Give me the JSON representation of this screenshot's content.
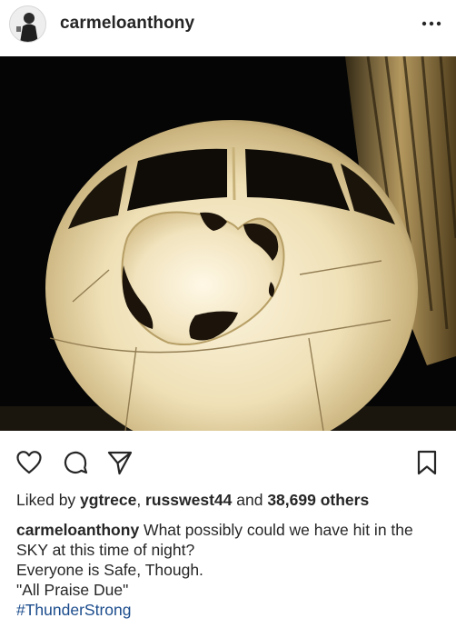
{
  "post": {
    "username": "carmeloanthony",
    "more_icon": "ellipsis-icon",
    "likes": {
      "prefix": "Liked by ",
      "user1": "ygtrece",
      "sep": ", ",
      "user2": "russwest44",
      "middle": " and ",
      "count": "38,699 others"
    },
    "caption": {
      "username": "carmeloanthony",
      "text": " What possibly could we have hit in the SKY at this time of night?",
      "line2": "Everyone is Safe, Though.",
      "line3": "\"All Praise Due\"",
      "hashtag": "#ThunderStrong"
    },
    "actions": [
      "heart-icon",
      "comment-icon",
      "share-icon",
      "bookmark-icon"
    ]
  }
}
